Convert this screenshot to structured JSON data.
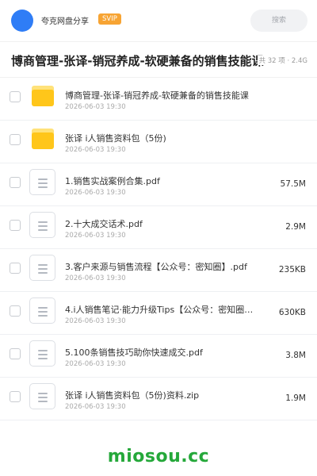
{
  "header": {
    "site_name": "夸克网盘分享",
    "badge": "SVIP",
    "search_placeholder": "搜索"
  },
  "folder": {
    "title": "博商管理-张译-销冠养成-软硬兼备的销售技能课",
    "meta": "共 32 项 · 2.4G"
  },
  "files": [
    {
      "type": "folder",
      "name": "博商管理-张译-销冠养成-软硬兼备的销售技能课",
      "date": "2026-06-03 19:30",
      "size": ""
    },
    {
      "type": "folder",
      "name": "张译 i人销售资料包（5份)",
      "date": "2026-06-03 19:30",
      "size": ""
    },
    {
      "type": "file",
      "name": "1.销售实战案例合集.pdf",
      "date": "2026-06-03 19:30",
      "size": "57.5M"
    },
    {
      "type": "file",
      "name": "2.十大成交话术.pdf",
      "date": "2026-06-03 19:30",
      "size": "2.9M"
    },
    {
      "type": "file",
      "name": "3.客户来源与销售流程【公众号：密知圈】.pdf",
      "date": "2026-06-03 19:30",
      "size": "235KB"
    },
    {
      "type": "file",
      "name": "4.i人销售笔记·能力升级Tips【公众号：密知圈…",
      "date": "2026-06-03 19:30",
      "size": "630KB"
    },
    {
      "type": "file",
      "name": "5.100条销售技巧助你快速成交.pdf",
      "date": "2026-06-03 19:30",
      "size": "3.8M"
    },
    {
      "type": "file",
      "name": "张译 i人销售资料包（5份)资料.zip",
      "date": "2026-06-03 19:30",
      "size": "1.9M"
    }
  ],
  "watermark": "miosou.cc",
  "colors": {
    "accent": "#2f7df6",
    "badge": "#f7a433",
    "folder": "#ffc61a",
    "watermark": "#25a83a"
  }
}
